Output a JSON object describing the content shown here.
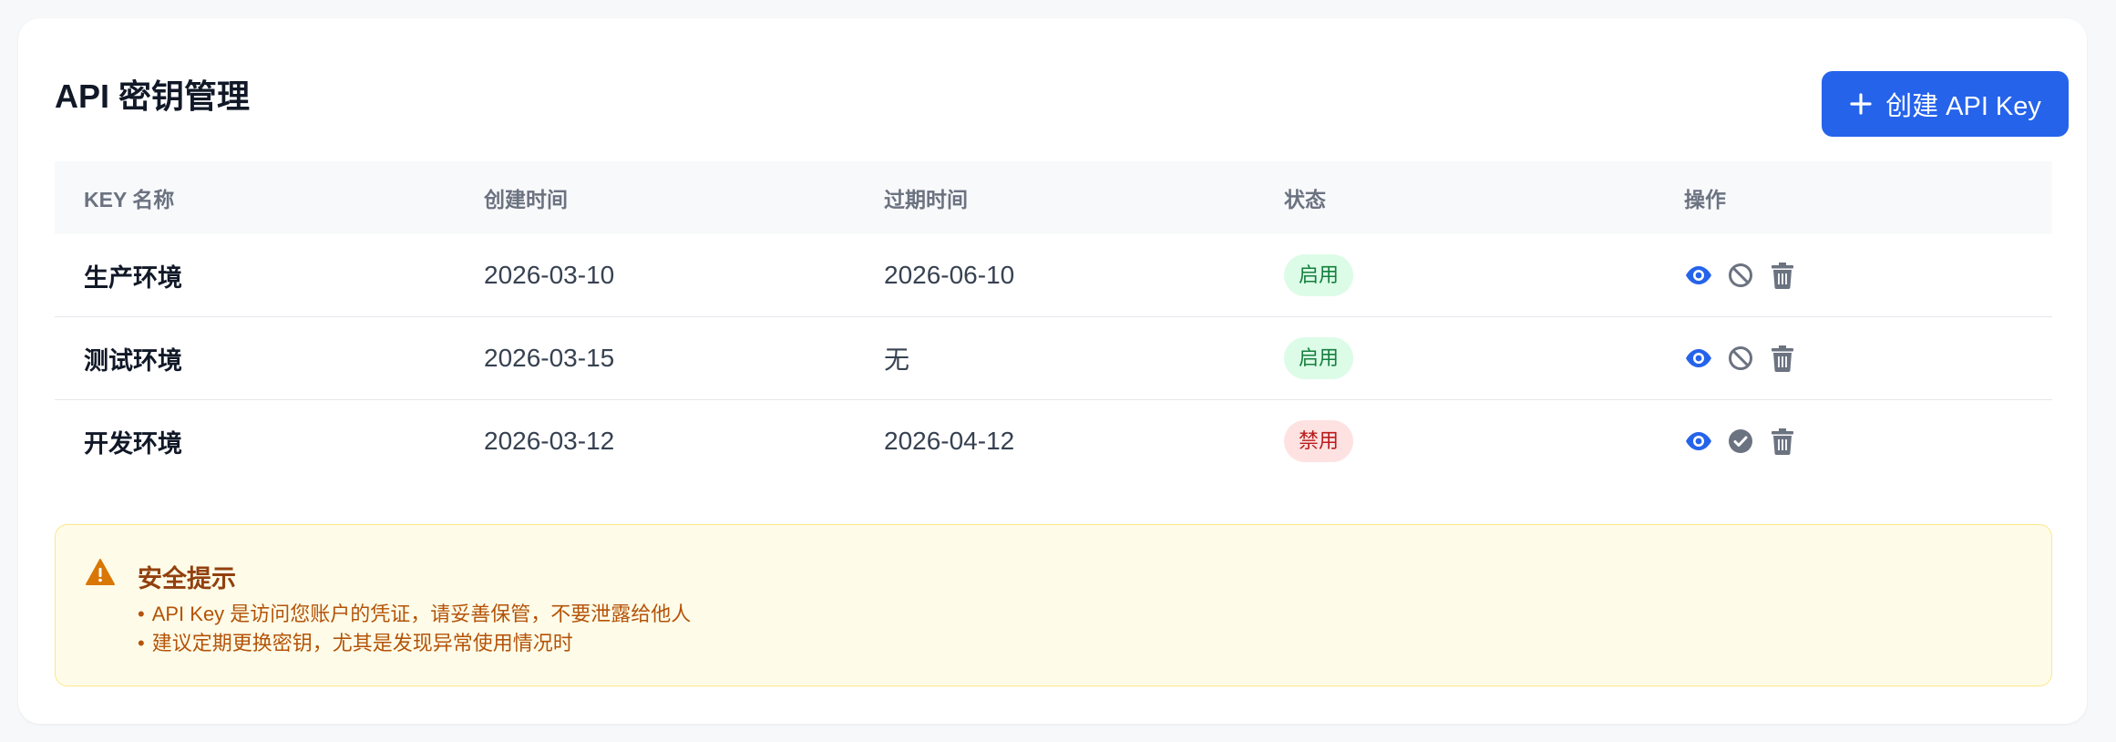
{
  "header": {
    "title": "API 密钥管理",
    "create_button_label": "创建 API Key"
  },
  "table": {
    "columns": [
      "KEY 名称",
      "创建时间",
      "过期时间",
      "状态",
      "操作"
    ],
    "rows": [
      {
        "name": "生产环境",
        "created": "2026-03-10",
        "expires": "2026-06-10",
        "status": "启用",
        "status_type": "enabled"
      },
      {
        "name": "测试环境",
        "created": "2026-03-15",
        "expires": "无",
        "status": "启用",
        "status_type": "enabled"
      },
      {
        "name": "开发环境",
        "created": "2026-03-12",
        "expires": "2026-04-12",
        "status": "禁用",
        "status_type": "disabled"
      }
    ]
  },
  "alert": {
    "title": "安全提示",
    "items": [
      "API Key 是访问您账户的凭证，请妥善保管，不要泄露给他人",
      "建议定期更换密钥，尤其是发现异常使用情况时"
    ]
  },
  "colors": {
    "primary": "#2563eb",
    "enabled_bg": "#dcfce7",
    "enabled_text": "#15803d",
    "disabled_bg": "#fee2e2",
    "disabled_text": "#b91c1c",
    "warning_bg": "#fefce8",
    "warning_text": "#b45309"
  }
}
